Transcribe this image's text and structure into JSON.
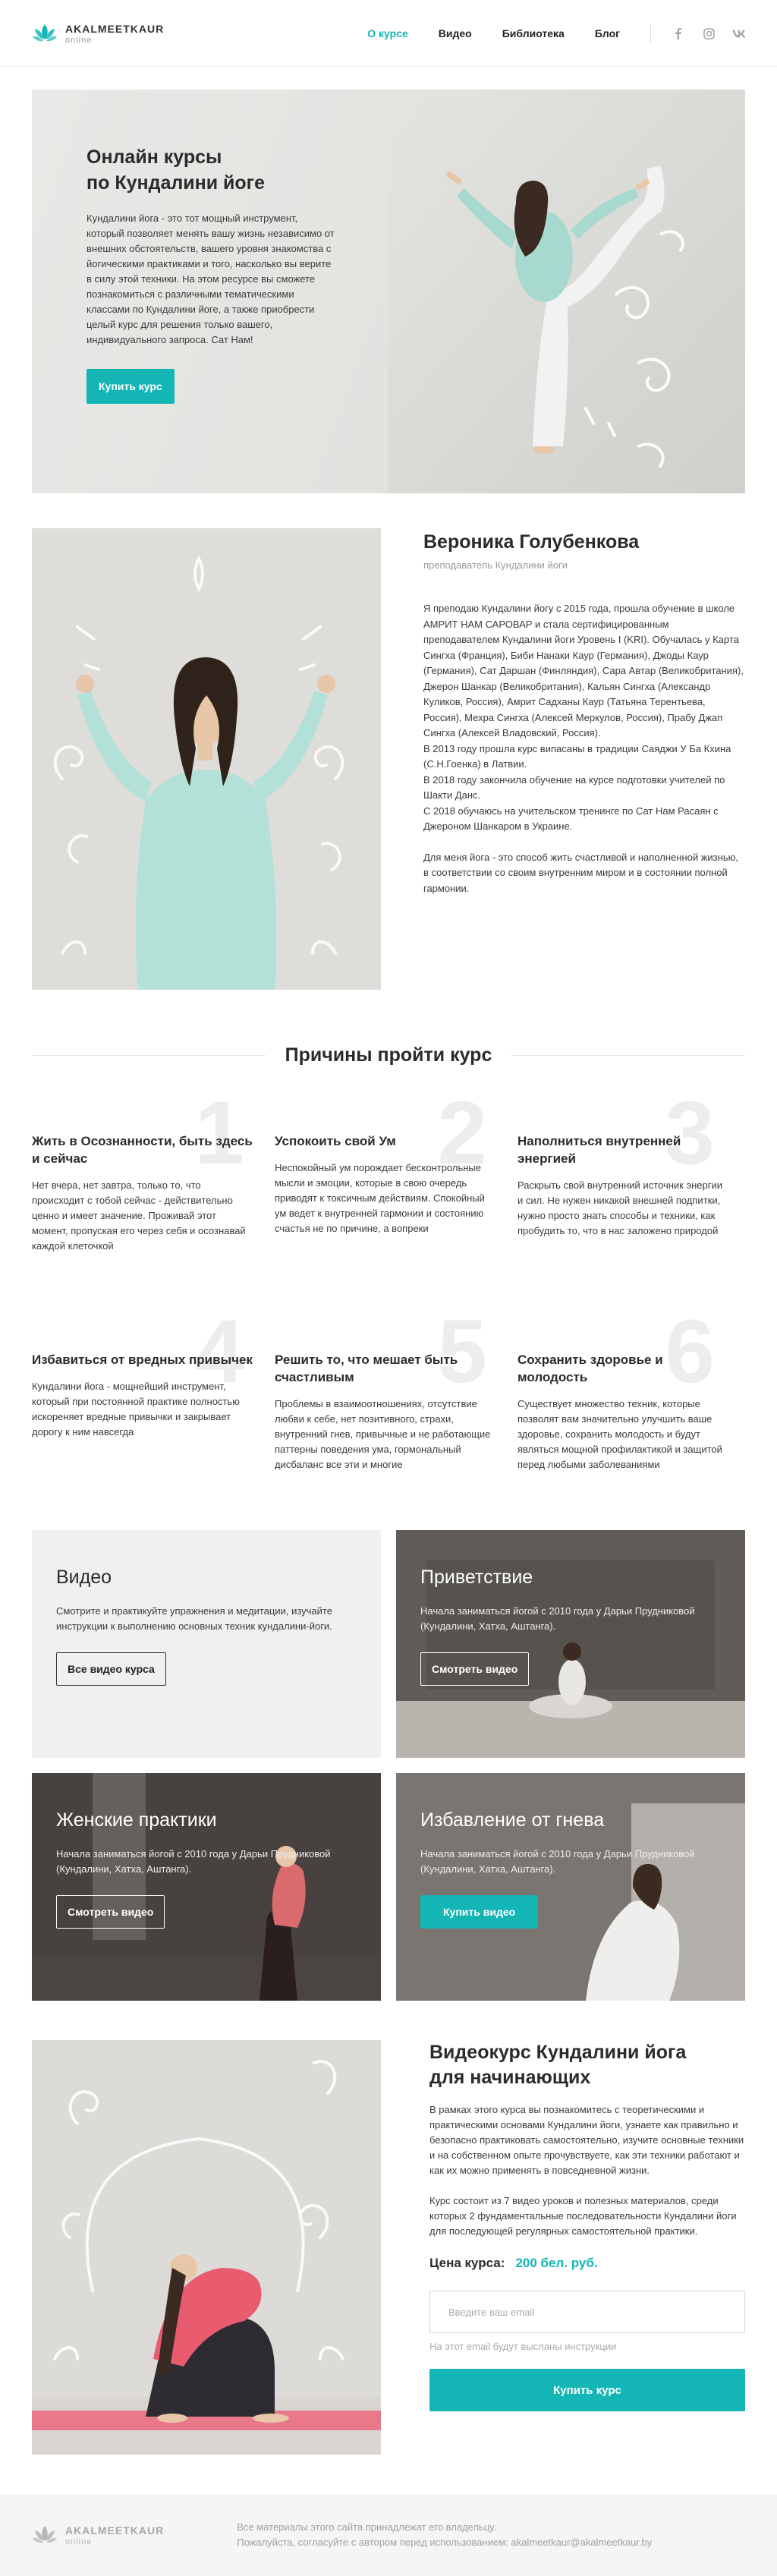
{
  "brand": {
    "name": "AKALMEETKAUR",
    "sub": "online",
    "accent": "#13b5b5"
  },
  "nav": {
    "items": [
      {
        "label": "О курсе",
        "active": true
      },
      {
        "label": "Видео"
      },
      {
        "label": "Библиотека"
      },
      {
        "label": "Блог"
      }
    ],
    "socials": [
      "facebook-icon",
      "instagram-icon",
      "vk-icon"
    ]
  },
  "hero": {
    "title_line1": "Онлайн курсы",
    "title_line2": "по Кундалини йоге",
    "text": "Кундалини йога - это тот мощный инструмент, который позволяет менять вашу жизнь независимо от внешних обстоятельств, вашего уровня знакомства с йогическими практиками и того, насколько вы верите в силу этой техники. На этом ресурсе вы сможете познакомиться с различными тематическими классами по Кундалини йоге, а также приобрести целый курс для решения только вашего, индивидуального запроса. Сат Нам!",
    "button": "Купить курс"
  },
  "teacher": {
    "name": "Вероника Голубенкова",
    "role": "преподаватель Кундалини йоги",
    "bio1": "Я преподаю Кундалини йогу с 2015 года, прошла обучение в школе АМРИТ НАМ САРОВАР и стала сертифицированным преподавателем Кундалини йоги Уровень I (KRI). Обучалась у Карта Сингха (Франция), Биби Нанаки Каур (Германия), Джоды Каур (Германия), Сат Даршан (Финляндия), Сара Автар (Великобритания), Джерон Шанкар (Великобритания), Кальян Сингха (Александр Куликов, Россия), Амрит Садханы Каур (Татьяна Терентьева, Россия), Мехра Сингха (Алексей Меркулов, Россия), Прабу Джап Сингха (Алексей Владовский, Россия).",
    "bio2": "В 2013 году прошла курс випасаны в традиции Саяджи У Ба Кхина (С.Н.Гоенка) в Латвии.",
    "bio3": "В 2018 году закончила обучение на курсе подготовки учителей по Шакти Данс.",
    "bio4": "С 2018 обучаюсь на учительском тренинге по Сат Нам Расаян с Джероном Шанкаром в Украине.",
    "bio5": "Для меня йога - это способ жить счастливой и наполненной жизнью, в соответствии со своим внутренним миром и в состоянии полной гармонии."
  },
  "reasons": {
    "title": "Причины пройти курс",
    "items": [
      {
        "num": "1",
        "title": "Жить в Осознанности, быть здесь и сейчас",
        "text": "Нет вчера, нет завтра, только то, что происходит с тобой сейчас - действительно ценно и имеет значение. Проживай этот момент, пропуская его через себя и осознавай каждой клеточкой"
      },
      {
        "num": "2",
        "title": "Успокоить свой Ум",
        "text": "Неспокойный ум порождает бесконтрольные мысли и эмоции, которые в свою очередь приводят к токсичным действиям. Спокойный ум ведет к внутренней гармонии и состоянию счастья не по причине, а вопреки"
      },
      {
        "num": "3",
        "title": "Наполниться внутренней энергией",
        "text": "Раскрыть свой внутренний источник энергии и сил. Не нужен никакой внешней подпитки, нужно просто знать способы и техники, как пробудить то, что в нас заложено природой"
      },
      {
        "num": "4",
        "title": "Избавиться от вредных привычек",
        "text": "Кундалини йога - мощнейший инструмент, который при постоянной практике полностью искореняет вредные привычки и закрывает дорогу к ним навсегда"
      },
      {
        "num": "5",
        "title": "Решить то, что мешает быть счастливым",
        "text": "Проблемы в взаимоотношениях, отсутствие любви к себе, нет позитивного, страхи, внутренний гнев, привычные и не работающие паттерны поведения ума, гормональный дисбаланс все эти и многие"
      },
      {
        "num": "6",
        "title": "Сохранить здоровье и молодость",
        "text": "Существует множество техник, которые позволят вам значительно улучшить ваше здоровье, сохранить молодость и будут являться мощной профилактикой и защитой перед любыми заболеваниями"
      }
    ]
  },
  "cards": [
    {
      "title": "Видео",
      "text": "Смотрите и практикуйте упражнения и медитации, изучайте инструкции к выполнению основных техник кундалини-йоги.",
      "button": "Все видео курса",
      "style": "plain"
    },
    {
      "title": "Приветствие",
      "text": "Начала заниматься йогой с 2010 года у Дарьи Прудниковой (Кундалини, Хатха, Аштанга).",
      "button": "Смотреть видео",
      "style": "dark"
    },
    {
      "title": "Женские практики",
      "text": "Начала заниматься йогой с 2010 года у Дарьи Прудниковой (Кундалини, Хатха, Аштанга).",
      "button": "Смотреть видео",
      "style": "dark"
    },
    {
      "title": "Избавление от гнева",
      "text": "Начала заниматься йогой с 2010 года у Дарьи Прудниковой (Кундалини, Хатха, Аштанга).",
      "button": "Купить видео",
      "style": "teal"
    }
  ],
  "course": {
    "title_line1": "Видеокурс Кундалини йога",
    "title_line2": "для начинающих",
    "text1": "В рамках этого курса вы познакомитесь с теоретическими и практическими основами Кундалини йоги, узнаете как правильно и безопасно практиковать самостоятельно, изучите основные техники и на собственном опыте прочувствуете, как эти техники работают и как их можно применять в повседневной жизни.",
    "text2": "Курс состоит из 7 видео уроков и полезных материалов, среди которых 2 фундаментальные последовательности Кундалини йоги для последующей регулярных самостоятельной практики.",
    "price_label": "Цена курса:",
    "price_value": "200 бел. руб.",
    "email_placeholder": "Введите ваш email",
    "email_hint": "На этот email будут высланы инструкции",
    "button": "Купить курс"
  },
  "footer": {
    "line1": "Все материалы этого сайта принадлежат его владельцу.",
    "line2": "Пожалуйста, согласуйте с автором перед использованием:",
    "email": "akalmeetkaur@akalmeetkaur.by"
  }
}
